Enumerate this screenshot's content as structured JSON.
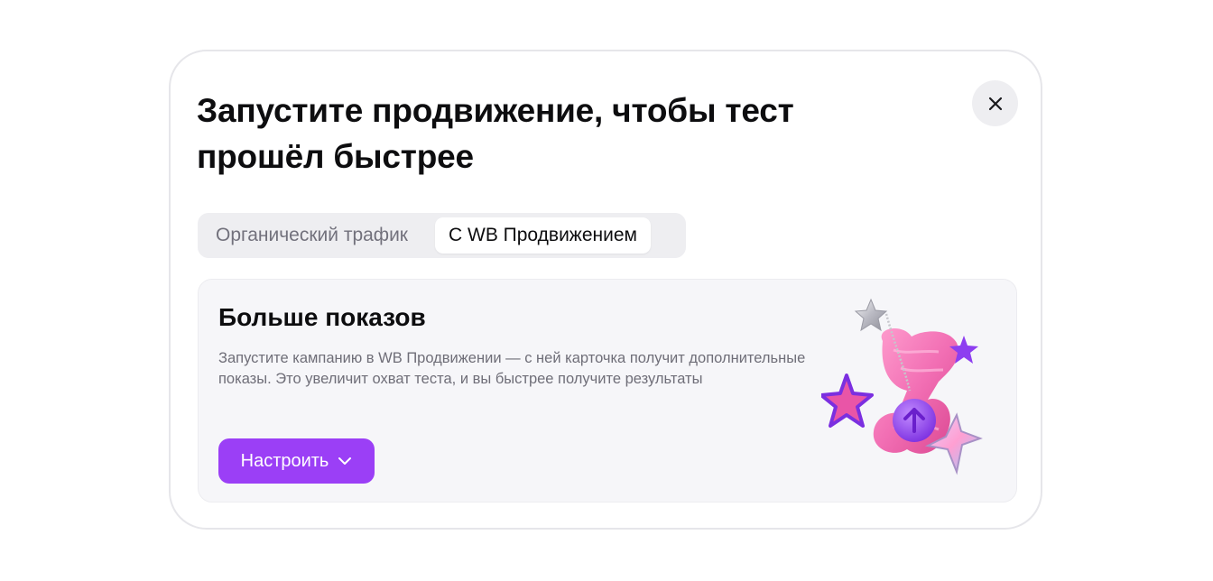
{
  "modal": {
    "title": "Запустите продвижение, чтобы тест прошёл быстрее",
    "close_icon": "close-icon"
  },
  "tabs": [
    {
      "label": "Органический трафик",
      "active": false
    },
    {
      "label": "С WB Продвижением",
      "active": true
    }
  ],
  "card": {
    "title": "Больше показов",
    "description": "Запустите кампанию в WB Продвижении — с ней карточка получит дополнительные показы. Это увеличит охват теста, и вы быстрее получите результаты",
    "button_label": "Настроить",
    "button_icon": "chevron-down-icon",
    "illustration": "promo-illustration"
  },
  "colors": {
    "accent": "#9b3ff6",
    "card_bg": "#f6f6f9",
    "tabs_bg": "#eeeef1",
    "muted_text": "#72717c"
  }
}
